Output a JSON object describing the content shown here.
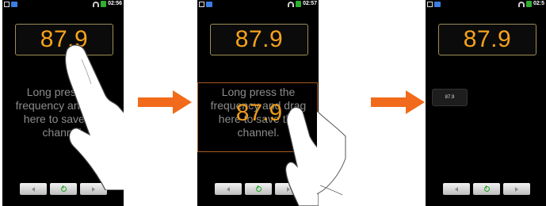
{
  "screens": [
    {
      "status": {
        "time": "02:56"
      },
      "frequency": "87.9",
      "hint_lines": [
        "Long press the",
        "frequency and drag",
        "here to save the",
        "channel."
      ]
    },
    {
      "status": {
        "time": "02:57"
      },
      "frequency": "87.9",
      "hint_lines": [
        "Long press the",
        "frequency and drag",
        "here to save the",
        "channel."
      ],
      "dragged_frequency": "87.9"
    },
    {
      "status": {
        "time": "02:5"
      },
      "frequency": "87.9",
      "saved_channel": "87.9"
    }
  ],
  "colors": {
    "frequency": "#f7a21c",
    "arrow": "#f26a1b",
    "frame": "#9a8e55"
  },
  "icons": {
    "prev": "triangle-left-icon",
    "power": "power-icon",
    "next": "triangle-right-icon"
  }
}
